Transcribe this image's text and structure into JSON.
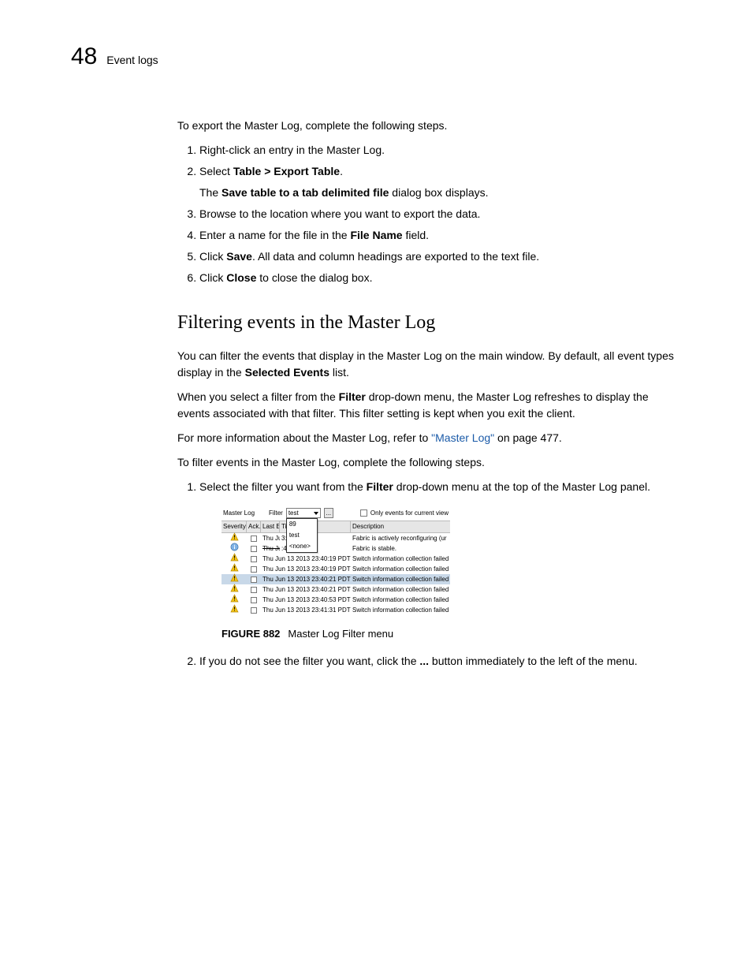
{
  "header": {
    "chapter": "48",
    "section": "Event logs"
  },
  "intro": "To export the Master Log, complete the following steps.",
  "export_steps": [
    {
      "text": "Right-click an entry in the Master Log."
    },
    {
      "pre": "Select ",
      "bold": "Table > Export Table",
      "post": ".",
      "sub_pre": "The ",
      "sub_bold": "Save table to a tab delimited file",
      "sub_post": " dialog box displays."
    },
    {
      "text": "Browse to the location where you want to export the data."
    },
    {
      "pre": "Enter a name for the file in the ",
      "bold": "File Name",
      "post": " field."
    },
    {
      "pre": "Click ",
      "bold": "Save",
      "post": ". All data and column headings are exported to the text file."
    },
    {
      "pre": "Click ",
      "bold": "Close",
      "post": " to close the dialog box."
    }
  ],
  "section_title": "Filtering events in the Master Log",
  "p1_pre": "You can filter the events that display in the Master Log on the main window. By default, all event types display in the ",
  "p1_bold": "Selected Events",
  "p1_post": " list.",
  "p2_pre": "When you select a filter from the ",
  "p2_bold": "Filter",
  "p2_post": " drop-down menu, the Master Log refreshes to display the events associated with that filter. This filter setting is kept when you exit the client.",
  "p3_pre": "For more information about the Master Log, refer to ",
  "p3_link": "\"Master Log\"",
  "p3_post": " on page 477.",
  "p4": "To filter events in the Master Log, complete the following steps.",
  "filter_step1_pre": "Select the filter you want from the ",
  "filter_step1_bold": "Filter",
  "filter_step1_post": " drop-down menu at the top of the Master Log panel.",
  "figure_caption_label": "FIGURE 882",
  "figure_caption_text": "Master Log Filter menu",
  "filter_step2_pre": "If you do not see the filter you want, click the ",
  "filter_step2_bold": "...",
  "filter_step2_post": " button immediately to the left of the menu.",
  "ml": {
    "title": "Master Log",
    "filter_label": "Filter",
    "filter_value": "test",
    "ellipsis": "...",
    "only_events": "Only events for current view",
    "dropdown": [
      "89",
      "test",
      "<none>"
    ],
    "cols": {
      "severity": "Severity",
      "ack": "Ack...",
      "last": "Last E",
      "time": "Time",
      "desc": "Description"
    },
    "rows": [
      {
        "sev": "warn",
        "last": "Thu Ju",
        "time": "3:33:09 PDT",
        "desc": "Fabric is actively reconfiguring (ur",
        "sel": false
      },
      {
        "sev": "info",
        "last": "Thu Jun 13 2013 23",
        "time": ":40:17 PDT",
        "desc": "Fabric is stable.",
        "sel": false,
        "strike": true
      },
      {
        "sev": "warn",
        "last": "",
        "time": "Thu Jun 13 2013 23:40:19 PDT",
        "desc": "Switch information collection failed",
        "sel": false
      },
      {
        "sev": "warn",
        "last": "",
        "time": "Thu Jun 13 2013 23:40:19 PDT",
        "desc": "Switch information collection failed",
        "sel": false
      },
      {
        "sev": "warn",
        "last": "",
        "time": "Thu Jun 13 2013 23:40:21 PDT",
        "desc": "Switch information collection failed",
        "sel": true
      },
      {
        "sev": "warn",
        "last": "",
        "time": "Thu Jun 13 2013 23:40:21 PDT",
        "desc": "Switch information collection failed",
        "sel": false
      },
      {
        "sev": "warn",
        "last": "",
        "time": "Thu Jun 13 2013 23:40:53 PDT",
        "desc": "Switch information collection failed",
        "sel": false
      },
      {
        "sev": "warn",
        "last": "",
        "time": "Thu Jun 13 2013 23:41:31 PDT",
        "desc": "Switch information collection failed",
        "sel": false
      }
    ]
  }
}
